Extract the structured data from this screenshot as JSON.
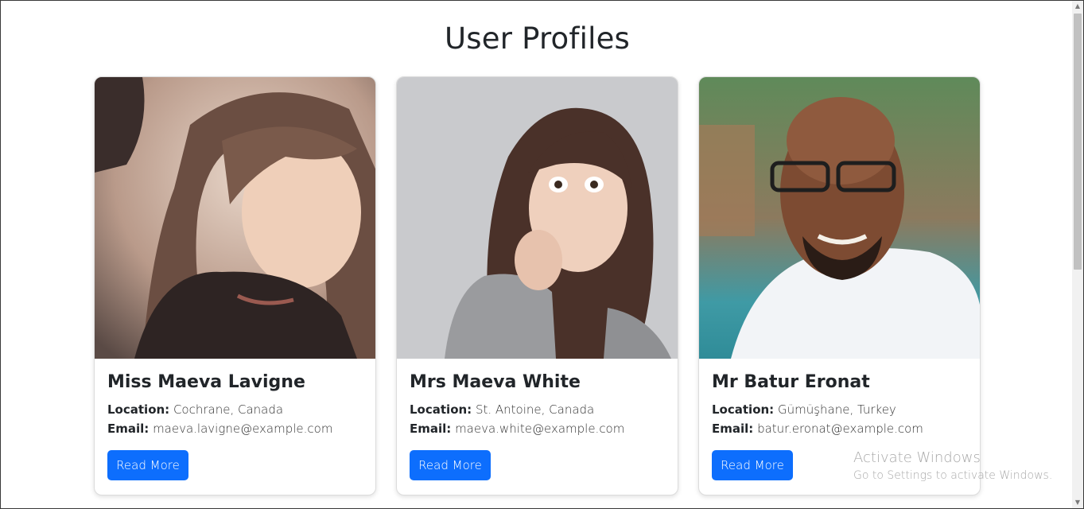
{
  "page": {
    "title": "User Profiles"
  },
  "profiles": [
    {
      "name": "Miss Maeva Lavigne",
      "location_label": "Location:",
      "location": "Cochrane, Canada",
      "email_label": "Email:",
      "email": "maeva.lavigne@example.com",
      "button": "Read More"
    },
    {
      "name": "Mrs Maeva White",
      "location_label": "Location:",
      "location": "St. Antoine, Canada",
      "email_label": "Email:",
      "email": "maeva.white@example.com",
      "button": "Read More"
    },
    {
      "name": "Mr Batur Eronat",
      "location_label": "Location:",
      "location": "Gümüşhane, Turkey",
      "email_label": "Email:",
      "email": "batur.eronat@example.com",
      "button": "Read More"
    }
  ],
  "watermark": {
    "line1": "Activate Windows",
    "line2": "Go to Settings to activate Windows."
  },
  "colors": {
    "primary": "#0d6efd",
    "text": "#212529"
  }
}
